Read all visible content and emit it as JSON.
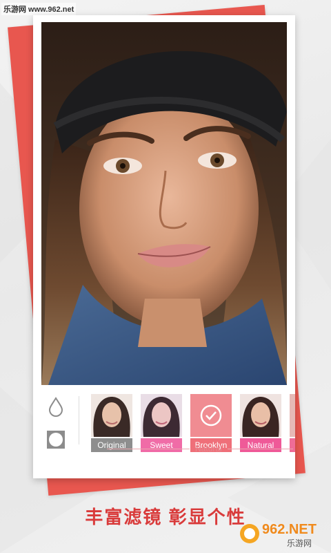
{
  "site_watermark": "乐游网 www.962.net",
  "filters": {
    "section_label": "Natural",
    "items": [
      {
        "label": "Original",
        "label_color": "#8e8e8e",
        "selected": false
      },
      {
        "label": "Sweet",
        "label_color": "#f06ca7",
        "selected": false
      },
      {
        "label": "Brooklyn",
        "label_color": "#ef6f79",
        "selected": true
      },
      {
        "label": "Natural",
        "label_color": "#ef5a98",
        "selected": false
      }
    ]
  },
  "tools": {
    "top_icon": "droplet-icon",
    "bottom_icon": "circle-square-icon"
  },
  "slogan": "丰富滤镜  彰显个性",
  "brand": {
    "logo_text": "962.NET",
    "logo_subtext": "乐游网"
  },
  "colors": {
    "accent_red": "#e8574f",
    "slogan_red": "#d93b3b"
  }
}
